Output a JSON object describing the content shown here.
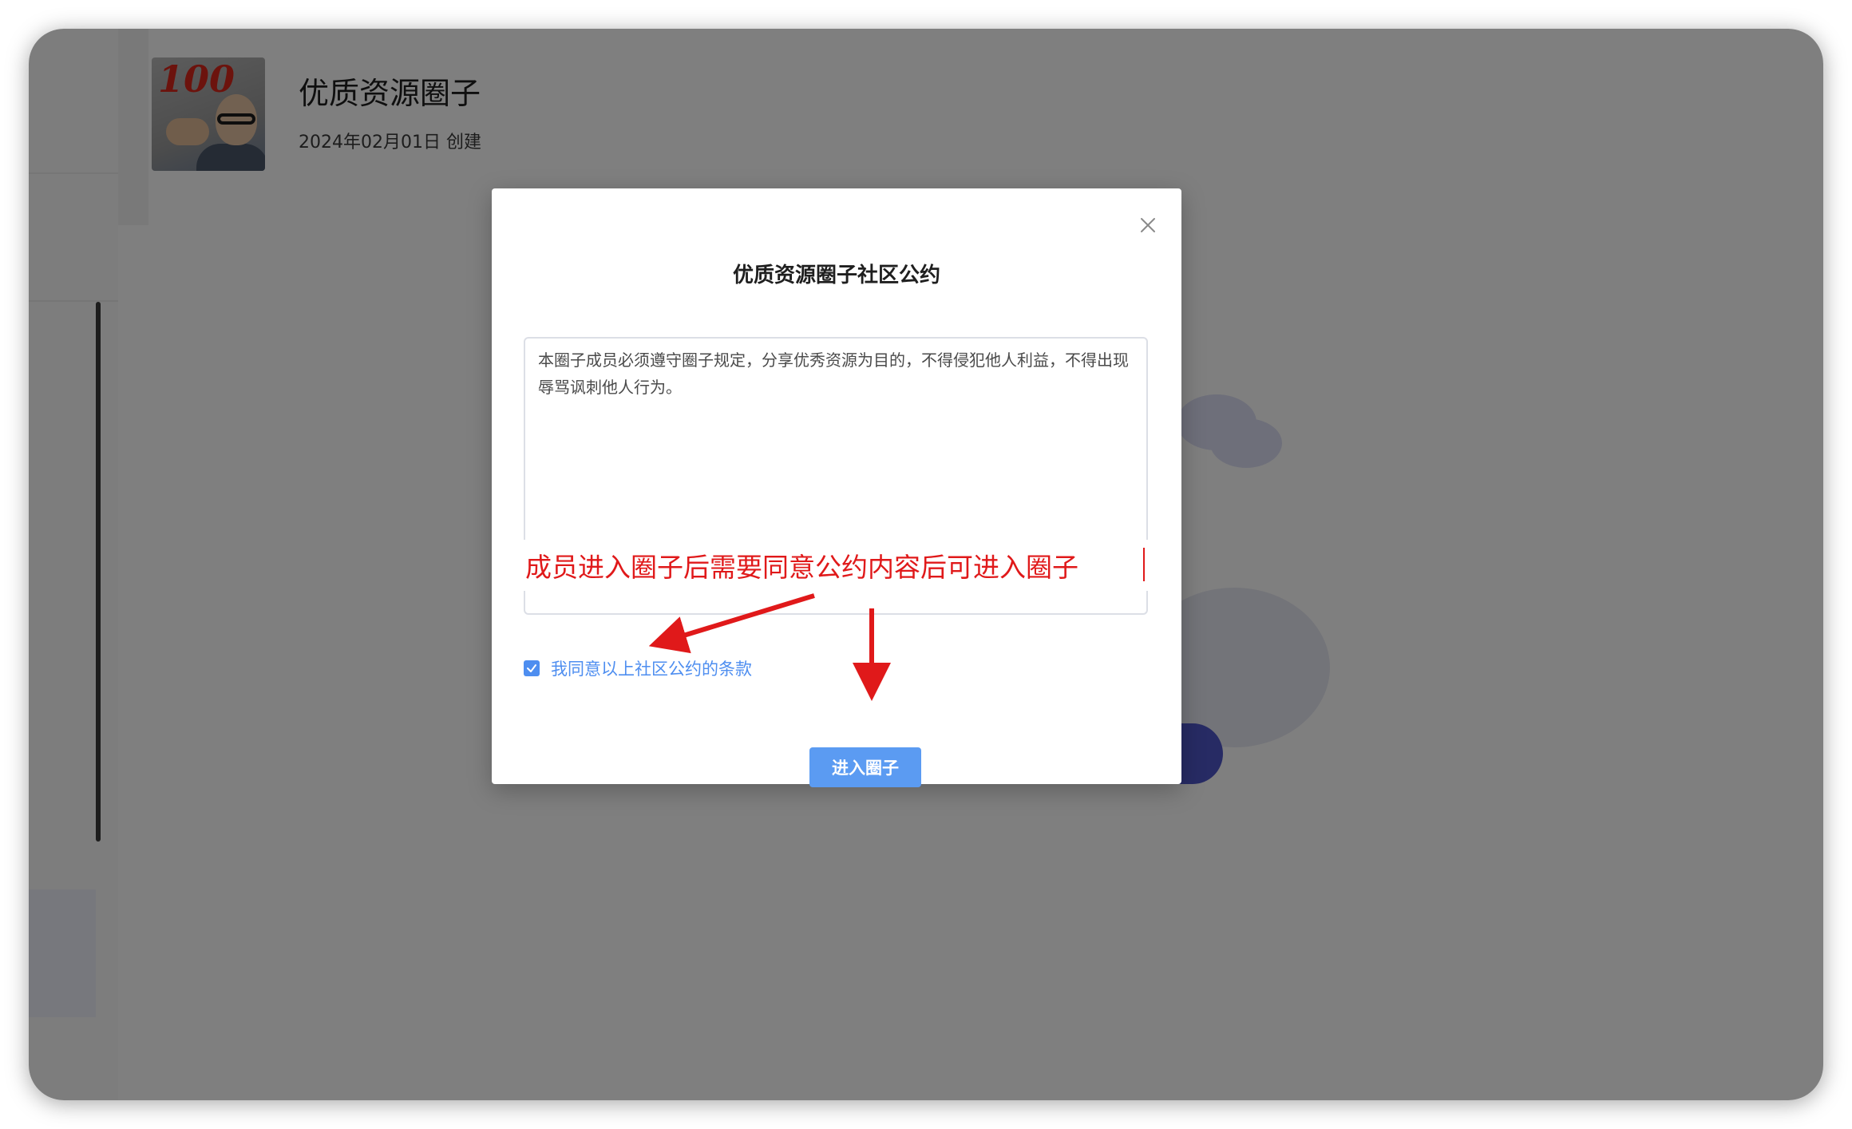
{
  "group": {
    "title": "优质资源圈子",
    "meta": "2024年02月01日 创建"
  },
  "modal": {
    "title": "优质资源圈子社区公约",
    "agreement_text": "本圈子成员必须遵守圈子规定，分享优秀资源为目的，不得侵犯他人利益，不得出现辱骂讽刺他人行为。",
    "checkbox_label": "我同意以上社区公约的条款",
    "checkbox_checked": true,
    "enter_button_label": "进入圈子"
  },
  "annotation": {
    "text": "成员进入圈子后需要同意公约内容后可进入圈子",
    "color": "#e0191a"
  },
  "colors": {
    "accent": "#4e8ef0",
    "button": "#5b9bf2",
    "overlay": "rgba(0,0,0,0.5)"
  },
  "icons": {
    "close": "close-icon",
    "check": "check-icon",
    "arrow": "arrow-icon"
  }
}
